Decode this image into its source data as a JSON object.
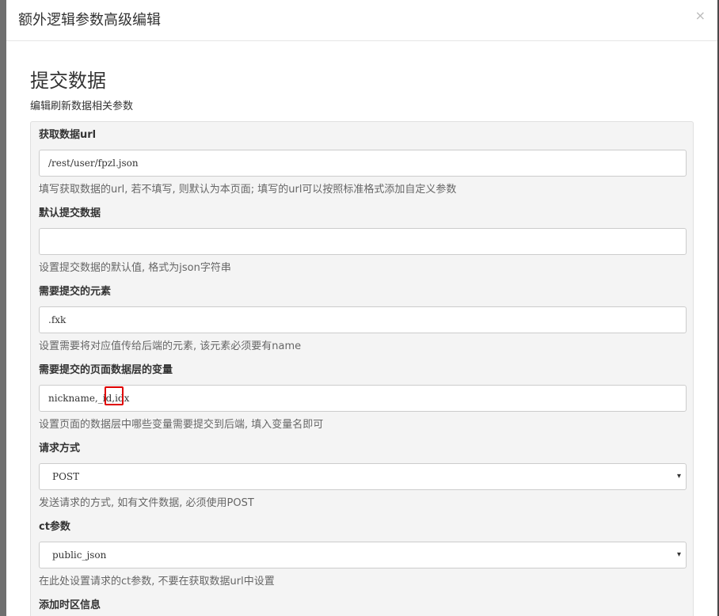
{
  "dialog": {
    "title": "额外逻辑参数高级编辑",
    "close_glyph": "×"
  },
  "section": {
    "title": "提交数据",
    "subtitle": "编辑刷新数据相关参数"
  },
  "fields": [
    {
      "label": "获取数据url",
      "value": "/rest/user/fpzl.json",
      "help": "填写获取数据的url, 若不填写, 则默认为本页面; 填写的url可以按照标准格式添加自定义参数"
    },
    {
      "label": "默认提交数据",
      "value": "",
      "help": "设置提交数据的默认值, 格式为json字符串"
    },
    {
      "label": "需要提交的元素",
      "value": ".fxk",
      "help": "设置需要将对应值传给后端的元素, 该元素必须要有name"
    },
    {
      "label": "需要提交的页面数据层的变量",
      "value": "nickname,_id,idx",
      "help": "设置页面的数据层中哪些变量需要提交到后端, 填入变量名即可"
    },
    {
      "label": "请求方式",
      "value": "POST",
      "help": "发送请求的方式, 如有文件数据, 必须使用POST"
    },
    {
      "label": "ct参数",
      "value": "public_json",
      "help": "在此处设置请求的ct参数, 不要在获取数据url中设置"
    },
    {
      "label": "添加时区信息"
    }
  ],
  "icons": {
    "select_arrow": "▾"
  },
  "colors": {
    "highlight": "#e00000"
  }
}
